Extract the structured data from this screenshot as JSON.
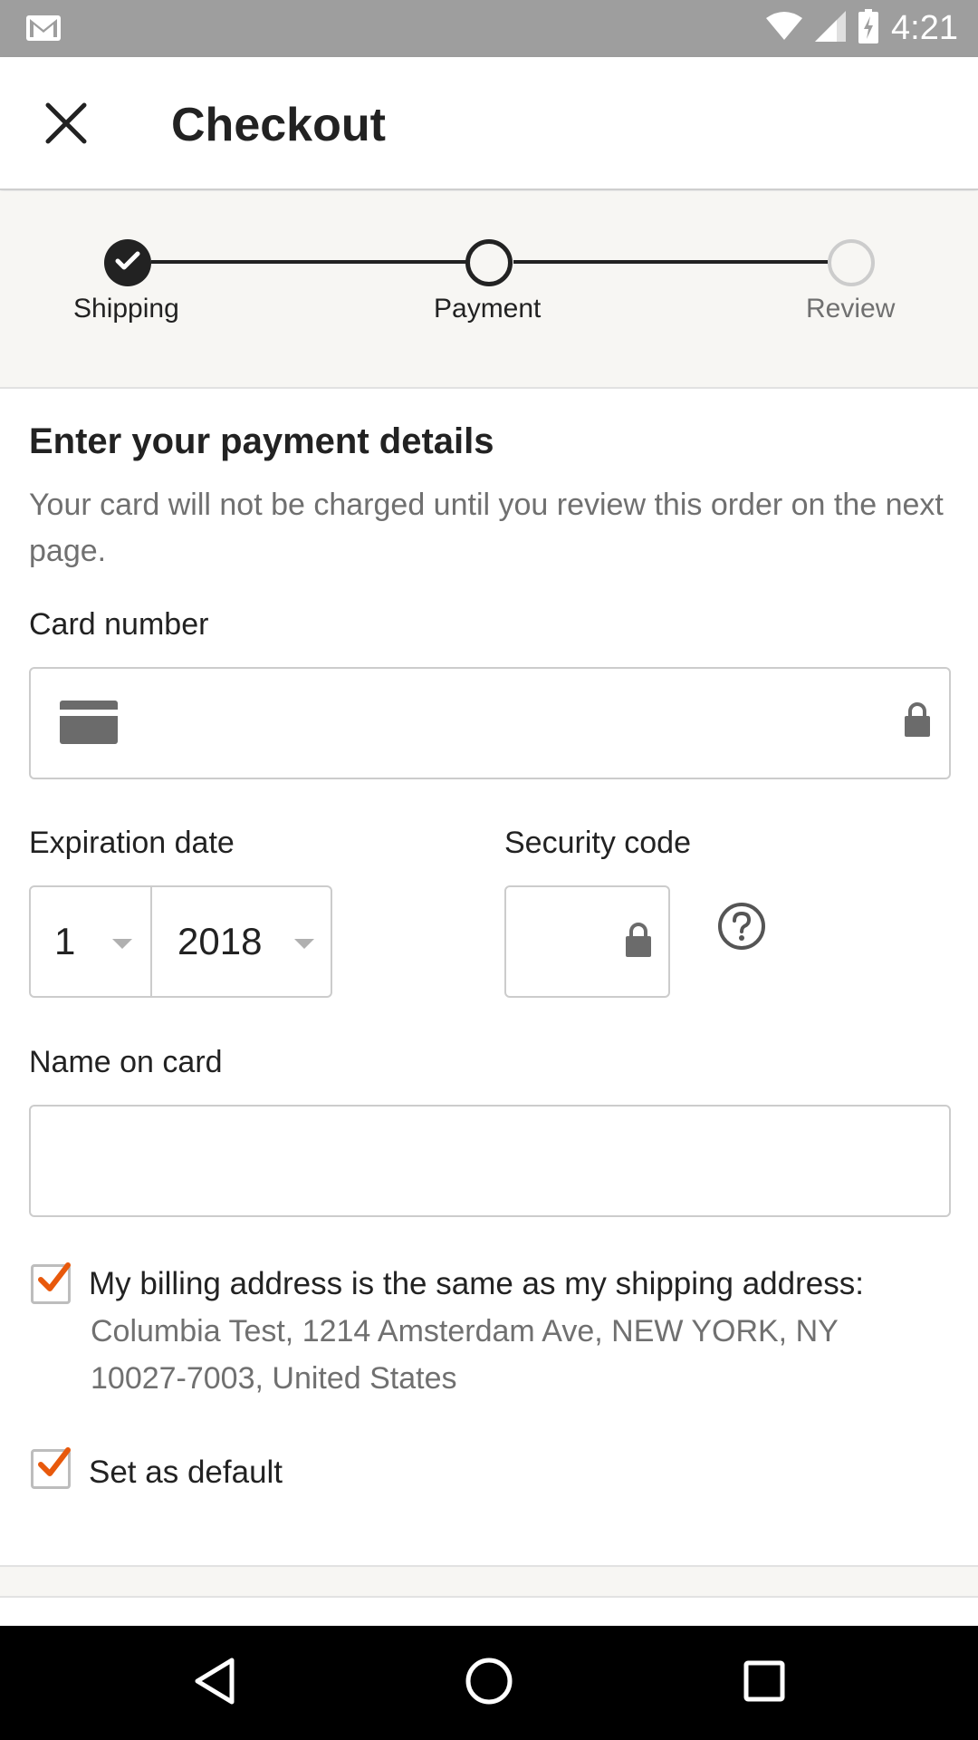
{
  "status_bar": {
    "time": "4:21",
    "icons": [
      "gmail-icon",
      "wifi-icon",
      "signal-icon",
      "battery-charging-icon"
    ]
  },
  "app_bar": {
    "title": "Checkout",
    "close_icon": "close-icon"
  },
  "stepper": {
    "steps": [
      {
        "label": "Shipping",
        "state": "complete"
      },
      {
        "label": "Payment",
        "state": "current"
      },
      {
        "label": "Review",
        "state": "upcoming"
      }
    ]
  },
  "form": {
    "heading": "Enter your payment details",
    "subtext": "Your card will not be charged until you review this order on the next page.",
    "card_number": {
      "label": "Card number",
      "value": ""
    },
    "expiration": {
      "label": "Expiration date",
      "month": "1",
      "year": "2018"
    },
    "security_code": {
      "label": "Security code",
      "value": ""
    },
    "name_on_card": {
      "label": "Name on card",
      "value": ""
    },
    "billing_same": {
      "checked": true,
      "label": "My billing address is the same as my shipping address:",
      "address": "Columbia Test, 1214 Amsterdam Ave, NEW YORK, NY 10027-7003, United States"
    },
    "set_default": {
      "checked": true,
      "label": "Set as default"
    }
  },
  "colors": {
    "accent_check": "#e8590c",
    "stepper_bg": "#f7f6f3",
    "status_bar_bg": "#9e9e9e",
    "text_primary": "#222222",
    "text_secondary": "#707070"
  },
  "nav_bar": {
    "buttons": [
      "back-icon",
      "home-icon",
      "recents-icon"
    ]
  }
}
